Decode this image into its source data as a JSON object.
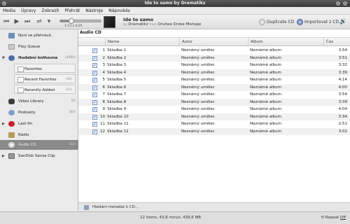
{
  "window": {
    "title": "Ide to samo by Dramatikz"
  },
  "menu": [
    "Media",
    "Úpravy",
    "Zobrazit",
    "Přehrát",
    "Nástroje",
    "Nápověda"
  ],
  "player": {
    "time": "1:13 z 4:25",
    "progress": 0.28,
    "track_title": "Ide to samo",
    "by_word": "by",
    "artist": "Dramatikz",
    "from_word": "from",
    "album": "Druhee Drzee Mixtape"
  },
  "toolbar": {
    "duplicate_label": "Duplicate CD",
    "import_label": "Importovat z CD"
  },
  "sidebar": {
    "items": [
      {
        "label": "Nyní se přehrává",
        "count": ""
      },
      {
        "label": "Play Queue",
        "count": ""
      },
      {
        "label": "Hudební knihovna",
        "count": "(4669)"
      },
      {
        "label": "Favorites",
        "count": ""
      },
      {
        "label": "Recent Favorites",
        "count": "(50)"
      },
      {
        "label": "Recently Added",
        "count": "(22)"
      },
      {
        "label": "Video Library",
        "count": "(0)"
      },
      {
        "label": "Podcasty",
        "count": "(84)"
      },
      {
        "label": "Last.fm",
        "count": ""
      },
      {
        "label": "Rádio",
        "count": ""
      },
      {
        "label": "Audio CD",
        "count": "(12)"
      },
      {
        "label": "SanDisk Sansa Clip",
        "count": ""
      }
    ]
  },
  "content": {
    "heading": "Audio CD",
    "columns": [
      "Name",
      "Autor",
      "Album",
      "Čas"
    ],
    "tracks": [
      {
        "num": "1",
        "name": "Skladba 1",
        "author": "Neznámý umělec",
        "album": "Neznámé album",
        "time": "3:54"
      },
      {
        "num": "2",
        "name": "Skladba 2",
        "author": "Neznámý umělec",
        "album": "Neznámé album",
        "time": "3:51"
      },
      {
        "num": "3",
        "name": "Skladba 3",
        "author": "Neznámý umělec",
        "album": "Neznámé album",
        "time": "3:32"
      },
      {
        "num": "4",
        "name": "Skladba 4",
        "author": "Neznámý umělec",
        "album": "Neznámé album",
        "time": "3:39"
      },
      {
        "num": "5",
        "name": "Skladba 5",
        "author": "Neznámý umělec",
        "album": "Neznámé album",
        "time": "4:14"
      },
      {
        "num": "6",
        "name": "Skladba 6",
        "author": "Neznámý umělec",
        "album": "Neznámé album",
        "time": "4:00"
      },
      {
        "num": "7",
        "name": "Skladba 7",
        "author": "Neznámý umělec",
        "album": "Neznámé album",
        "time": "3:54"
      },
      {
        "num": "8",
        "name": "Skladba 8",
        "author": "Neznámý umělec",
        "album": "Neznámé album",
        "time": "3:39"
      },
      {
        "num": "9",
        "name": "Skladba 9",
        "author": "Neznámý umělec",
        "album": "Neznámé album",
        "time": "4:04"
      },
      {
        "num": "10",
        "name": "Skladba 10",
        "author": "Neznámý umělec",
        "album": "Neznámé album",
        "time": "3:34"
      },
      {
        "num": "11",
        "name": "Skladba 11",
        "author": "Neznámý umělec",
        "album": "Neznámé album",
        "time": "2:51"
      },
      {
        "num": "12",
        "name": "Skladba 12",
        "author": "Neznámý umělec",
        "album": "Neznámé album",
        "time": "3:01"
      }
    ]
  },
  "status": {
    "metadata": "Hledání metadat k CD...",
    "summary": "12 items, 43,6 minut, 439,6 MB",
    "repeat_label": "Repeat",
    "repeat_value": "Off"
  },
  "colors": {
    "selected_bg": "#8a8a8a",
    "checkbox": "#2a5ca8",
    "alt_row": "#f1f1f1"
  },
  "icons": [
    "previous-icon",
    "play-icon",
    "next-icon",
    "shuffle-icon",
    "volume-icon",
    "cd-icon",
    "import-icon",
    "music-note-icon",
    "video-icon",
    "podcast-icon",
    "lastfm-icon",
    "radio-icon",
    "device-icon",
    "search-icon"
  ]
}
